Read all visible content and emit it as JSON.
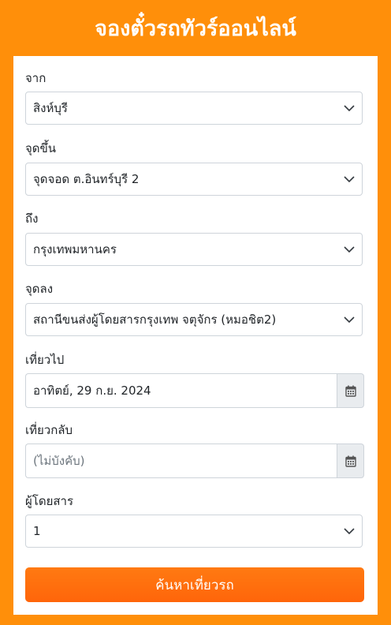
{
  "header": {
    "title": "จองตั๋วรถทัวร์ออนไลน์"
  },
  "form": {
    "from": {
      "label": "จาก",
      "value": "สิงห์บุรี"
    },
    "pickup": {
      "label": "จุดขึ้น",
      "value": "จุดจอด ต.อินทร์บุรี 2"
    },
    "to": {
      "label": "ถึง",
      "value": "กรุงเทพมหานคร"
    },
    "dropoff": {
      "label": "จุดลง",
      "value": "สถานีขนส่งผู้โดยสารกรุงเทพ จตุจักร (หมอชิต2)"
    },
    "depart": {
      "label": "เที่ยวไป",
      "value": "อาทิตย์, 29 ก.ย. 2024",
      "icon": "calendar-icon"
    },
    "return": {
      "label": "เที่ยวกลับ",
      "placeholder": "(ไม่บังคับ)",
      "icon": "calendar-icon"
    },
    "passengers": {
      "label": "ผู้โดยสาร",
      "value": "1"
    },
    "search_button": {
      "label": "ค้นหาเที่ยวรถ"
    }
  },
  "colors": {
    "background": "#ff8f0a",
    "button": "#ff6a0b",
    "card": "#ffffff"
  }
}
